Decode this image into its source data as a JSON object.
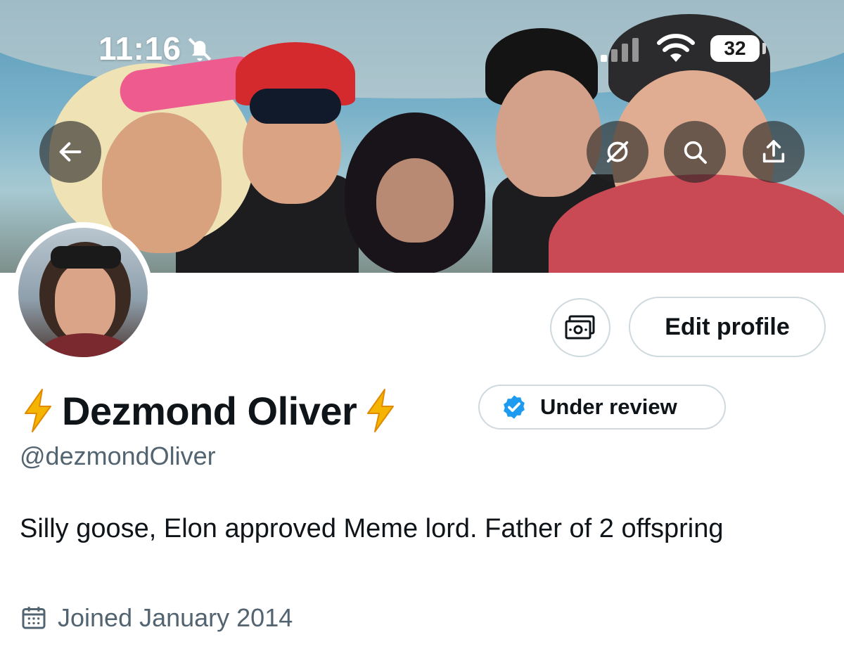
{
  "status_bar": {
    "time": "11:16",
    "battery": "32"
  },
  "banner": {
    "description_icons": [
      "back-arrow-icon",
      "grok-icon",
      "search-icon",
      "share-icon"
    ]
  },
  "profile": {
    "name": "Dezmond Oliver",
    "name_prefix_emoji": "⚡",
    "name_suffix_emoji": "⚡",
    "verification_label": "Under review",
    "handle": "@dezmondOliver",
    "bio": "Silly goose, Elon approved Meme lord. Father of 2 offspring",
    "joined": "Joined January 2014"
  },
  "actions": {
    "edit_profile": "Edit profile",
    "money_icon": "money-icon"
  },
  "colors": {
    "verified_blue": "#1d9bf0",
    "secondary_text": "#536471",
    "border": "#cfd9de",
    "bolt_yellow": "#f4b400"
  }
}
